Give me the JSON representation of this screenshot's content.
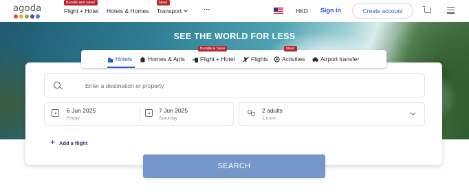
{
  "nav": {
    "logo_text": "agoda",
    "logo_colors": [
      "#e04b3d",
      "#f3a833",
      "#74b845",
      "#6b3fa0",
      "#2b83d8"
    ],
    "flight_hotel_badge": "Bundle and save!",
    "flight_hotel": "Flight + Hotel",
    "hotels_homes": "Hotels & Homes",
    "transport_badge": "New!",
    "transport": "Transport",
    "more": "···",
    "currency": "HKD",
    "sign_in": "Sign in",
    "create_account": "Create account"
  },
  "hero": {
    "title": "SEE THE WORLD FOR LESS"
  },
  "tabs": {
    "hotels": "Hotels",
    "homes": "Homes & Apts",
    "flight_hotel_badge": "Bundle & Save",
    "flight_hotel": "Flight + Hotel",
    "flights": "Flights",
    "activities_badge": "New!",
    "activities": "Activities",
    "airport_transfer": "Airport transfer",
    "active": "Hotels"
  },
  "search": {
    "destination_placeholder": "Enter a destination or property",
    "checkin_date": "6 Jun 2025",
    "checkin_day": "Friday",
    "checkout_date": "7 Jun 2025",
    "checkout_day": "Saturday",
    "guests": "2 adults",
    "rooms": "1 room",
    "add_flight": "Add a flight",
    "search_button": "SEARCH"
  },
  "colors": {
    "brand_blue": "#2355c8",
    "search_button": "#7596c8",
    "badge_red": "#b7272d"
  }
}
